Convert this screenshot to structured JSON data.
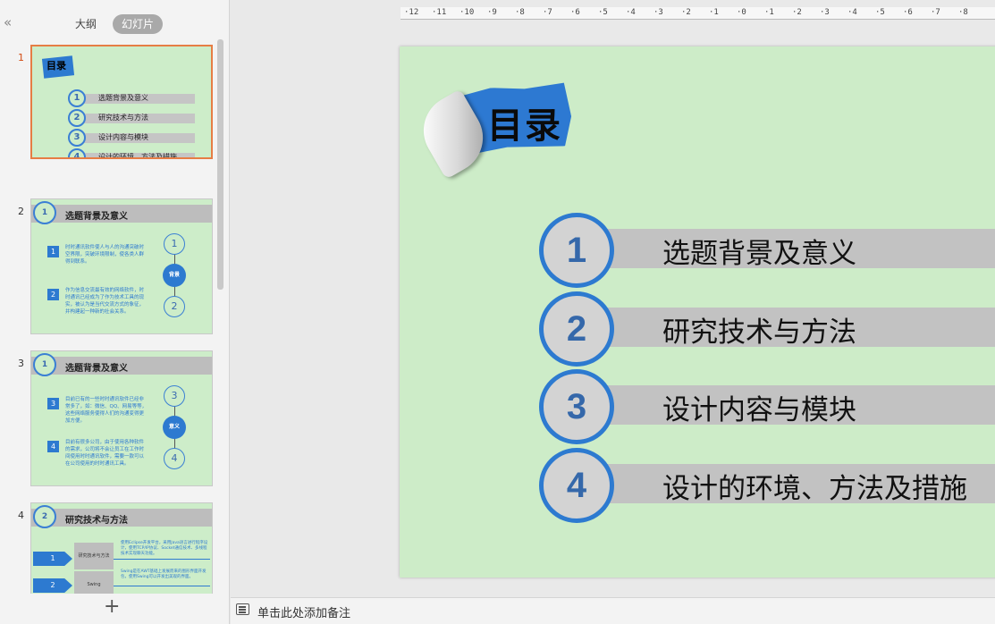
{
  "panel": {
    "collapse_glyph": "«",
    "tabs": [
      "大纲",
      "幻灯片"
    ],
    "add_glyph": "+"
  },
  "ruler": {
    "labels": [
      "12",
      "11",
      "10",
      "9",
      "8",
      "7",
      "6",
      "5",
      "4",
      "3",
      "2",
      "1",
      "0",
      "1",
      "2",
      "3",
      "4",
      "5",
      "6",
      "7",
      "8"
    ]
  },
  "thumbnails": [
    {
      "number": "1",
      "logo_text": "目录",
      "items": [
        "选题背景及意义",
        "研究技术与方法",
        "设计内容与模块",
        "设计的环境、方法及措施"
      ]
    },
    {
      "number": "2",
      "badge": "1",
      "title": "选题背景及意义",
      "blocks": [
        {
          "num": "1",
          "text": "时时通讯软件使人与人的沟通突破时空界限，突破环境限制，使各类人群得到联系。"
        },
        {
          "num": "2",
          "text": "作为信息交流最有效的网络软件，时时通讯已经成为了作为技术工具的现实，被认为是当代交流方式的象征，并构建起一种新的社会关系。"
        }
      ],
      "rings": [
        "1",
        "2"
      ],
      "dot_label": "背景"
    },
    {
      "number": "3",
      "badge": "1",
      "title": "选题背景及意义",
      "blocks": [
        {
          "num": "3",
          "text": "目前已有的一些时时通讯软件已经非常多了，如：微信、QQ、网易等等，这些网络服务使得人们的沟通变得更加方便。"
        },
        {
          "num": "4",
          "text": "目前有很多公司，由于使用各种软件的需求，公司将不会让员工在工作时间使用时时通讯软件，需要一款可以在公司使用的时时通讯工具。"
        }
      ],
      "rings": [
        "3",
        "4"
      ],
      "dot_label": "意义"
    },
    {
      "number": "4",
      "badge": "2",
      "title": "研究技术与方法",
      "rows": [
        {
          "arrow": "1",
          "block": "研究技术与方法",
          "text": "使用Eclipse开发平台，采用Java语言进行程序设计，使用TCP/IP协议、Socket通信技术、多线程技术实现聊天功能。"
        },
        {
          "arrow": "2",
          "block": "Swing",
          "text": "Swing是在AWT基础上发展而来的图形界面开发包，使用Swing可以开发出美观的界面。"
        }
      ]
    }
  ],
  "slide": {
    "logo_text": "目录",
    "items": [
      {
        "num": "1",
        "text": "选题背景及意义"
      },
      {
        "num": "2",
        "text": "研究技术与方法"
      },
      {
        "num": "3",
        "text": "设计内容与模块"
      },
      {
        "num": "4",
        "text": "设计的环境、方法及措施"
      }
    ]
  },
  "notes": {
    "placeholder": "单击此处添加备注"
  },
  "colors": {
    "slide_bg": "#cdecc8",
    "accent_blue": "#2d7ad0",
    "bar_gray": "#c2c2c2",
    "active_border": "#e67d44"
  }
}
